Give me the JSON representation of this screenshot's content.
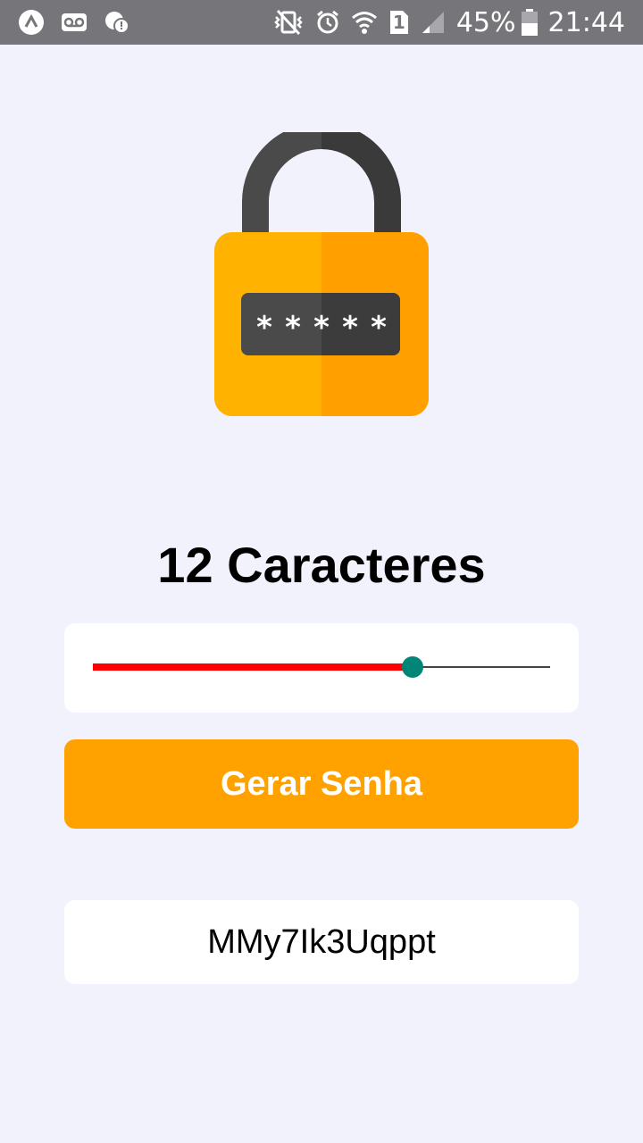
{
  "status_bar": {
    "left_icons": [
      "app-launcher-icon",
      "voicemail-icon",
      "chat-notification-icon"
    ],
    "right_icons": [
      "vibrate-mute-icon",
      "alarm-icon",
      "wifi-icon",
      "sim-1-icon",
      "signal-icon",
      "battery-icon"
    ],
    "sim_label": "1",
    "battery_percent": "45%",
    "time": "21:44"
  },
  "illustration": {
    "icon": "padlock-password-icon"
  },
  "length_title": "12 Caracteres",
  "slider": {
    "value_fraction": 0.7,
    "fill_color": "#ff0000",
    "thumb_color": "#008577"
  },
  "generate_button": {
    "label": "Gerar Senha",
    "color": "#ffa200"
  },
  "password_output": {
    "value": "MMy7Ik3Uqppt"
  }
}
